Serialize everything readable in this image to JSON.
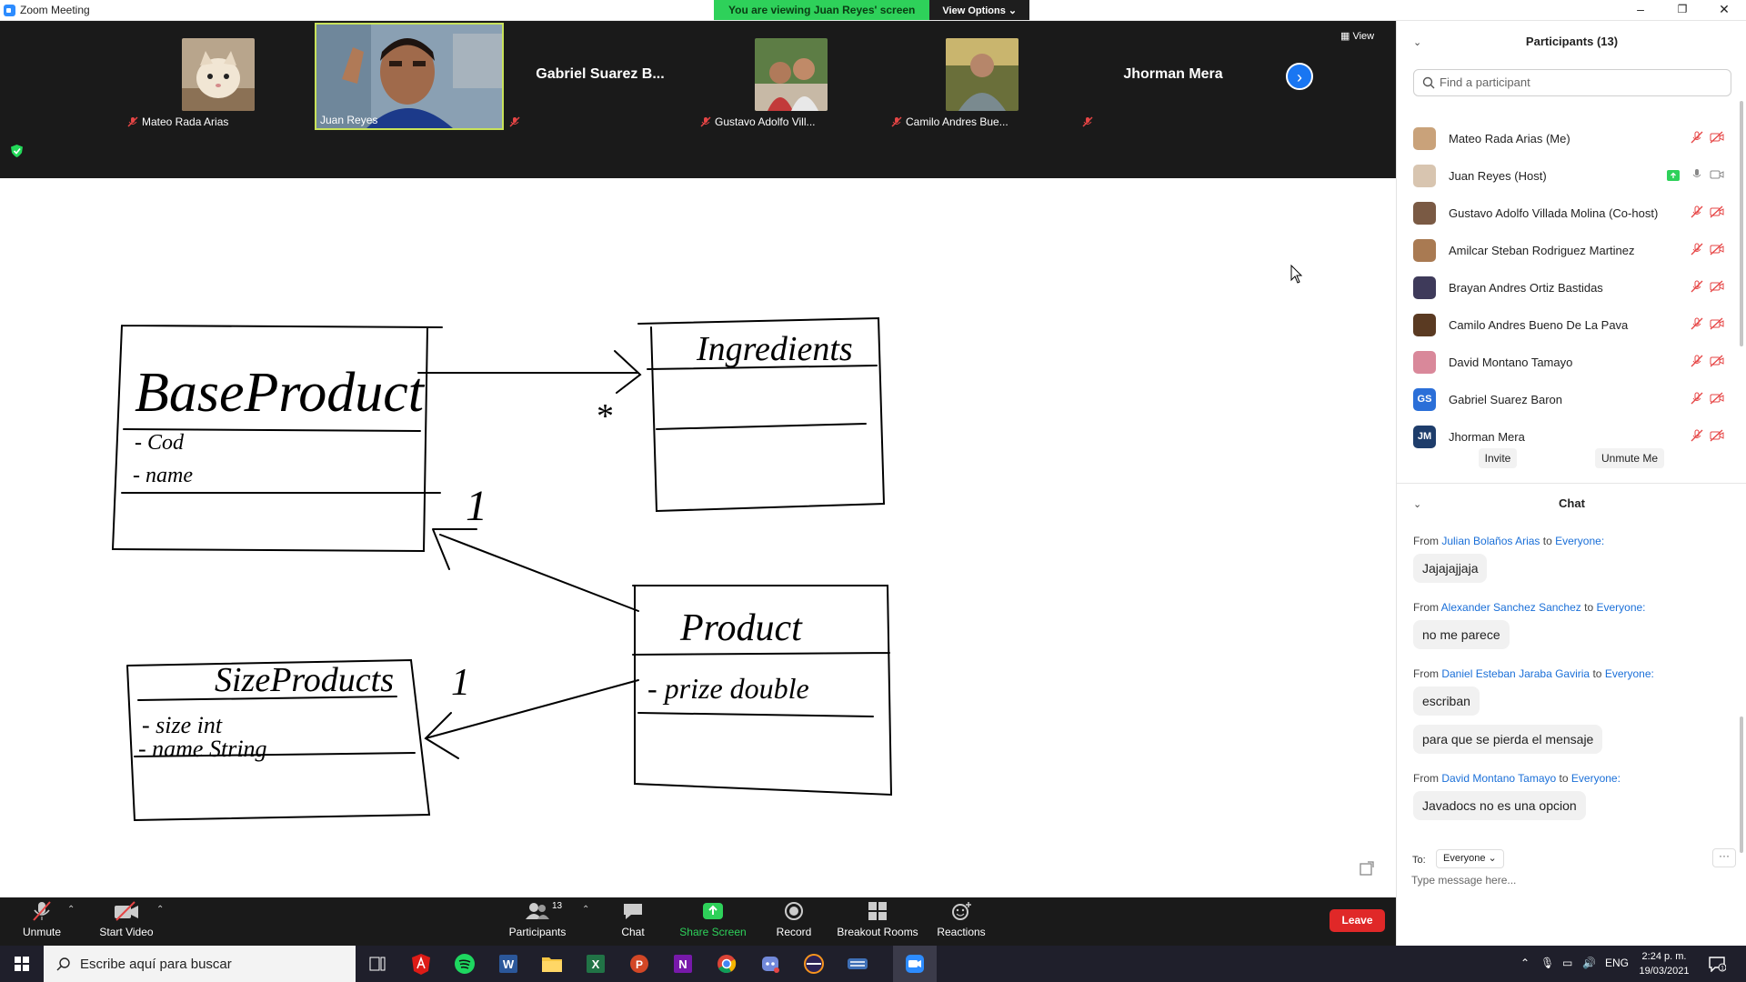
{
  "window": {
    "title": "Zoom Meeting",
    "minimize": "–",
    "restore": "❐",
    "close": "✕",
    "viewing_banner": "You are viewing Juan Reyes' screen",
    "view_options": "View Options ⌄"
  },
  "video_strip": {
    "tiles": [
      {
        "name": "Mateo Rada Arias"
      },
      {
        "name": "Juan Reyes"
      },
      {
        "name": "Gabriel Suarez B..."
      },
      {
        "name": "Gustavo Adolfo Vill..."
      },
      {
        "name": "Camilo Andres Bue..."
      },
      {
        "name": "Jhorman Mera"
      }
    ],
    "view_label": "View",
    "next_icon": "chevron-right-icon"
  },
  "whiteboard": {
    "classes": [
      {
        "title": "BaseProduct",
        "attributes": [
          "- Cod",
          "- name"
        ]
      },
      {
        "title": "Ingredients",
        "attributes": []
      },
      {
        "title": "Product",
        "attributes": [
          "- prize double"
        ]
      },
      {
        "title": "SizeProducts",
        "attributes": [
          "- size int",
          "- name String"
        ]
      }
    ],
    "multiplicities": [
      "*",
      "1",
      "1"
    ]
  },
  "toolbar": {
    "unmute": "Unmute",
    "start_video": "Start Video",
    "participants": "Participants",
    "participants_count": "13",
    "chat": "Chat",
    "share_screen": "Share Screen",
    "record": "Record",
    "breakout_rooms": "Breakout Rooms",
    "reactions": "Reactions",
    "leave": "Leave",
    "share_color": "#2ed15a",
    "leave_color": "#e02828"
  },
  "participants_panel": {
    "title": "Participants (13)",
    "search_placeholder": "Find a participant",
    "list": [
      {
        "name": "Mateo Rada Arias (Me)",
        "initials": "",
        "muted": true,
        "video_off": true
      },
      {
        "name": "Juan Reyes (Host)",
        "initials": "",
        "muted": false,
        "video_off": false,
        "sharing": true
      },
      {
        "name": "Gustavo Adolfo Villada Molina (Co-host)",
        "initials": "",
        "muted": true,
        "video_off": true
      },
      {
        "name": "Amilcar Steban Rodriguez Martinez",
        "initials": "",
        "muted": true,
        "video_off": true
      },
      {
        "name": "Brayan Andres Ortiz Bastidas",
        "initials": "",
        "muted": true,
        "video_off": true
      },
      {
        "name": "Camilo Andres Bueno De La Pava",
        "initials": "",
        "muted": true,
        "video_off": true
      },
      {
        "name": "David Montano Tamayo",
        "initials": "",
        "muted": true,
        "video_off": true
      },
      {
        "name": "Gabriel Suarez Baron",
        "initials": "GS",
        "muted": true,
        "video_off": true
      },
      {
        "name": "Jhorman Mera",
        "initials": "JM",
        "muted": true,
        "video_off": true
      }
    ],
    "invite": "Invite",
    "unmute_me": "Unmute Me"
  },
  "chat": {
    "title": "Chat",
    "from_word": "From",
    "to_word": "to",
    "messages": [
      {
        "from": "Julian Bolaños Arias",
        "to": "Everyone:",
        "texts": [
          "Jajajajjaja"
        ]
      },
      {
        "from": "Alexander Sanchez Sanchez",
        "to": "Everyone:",
        "texts": [
          "no me parece"
        ]
      },
      {
        "from": "Daniel Esteban Jaraba Gaviria",
        "to": "Everyone:",
        "texts": [
          "escriban",
          "para que se pierda el mensaje"
        ]
      },
      {
        "from": "David Montano Tamayo",
        "to": "Everyone:",
        "texts": [
          "Javadocs no es una opcion"
        ]
      }
    ],
    "to_label": "To:",
    "recipient": "Everyone ⌄",
    "more": "···",
    "input_placeholder": "Type message here..."
  },
  "taskbar": {
    "search_placeholder": "Escribe aquí para buscar",
    "language": "ENG",
    "time": "2:24 p. m.",
    "date": "19/03/2021"
  }
}
